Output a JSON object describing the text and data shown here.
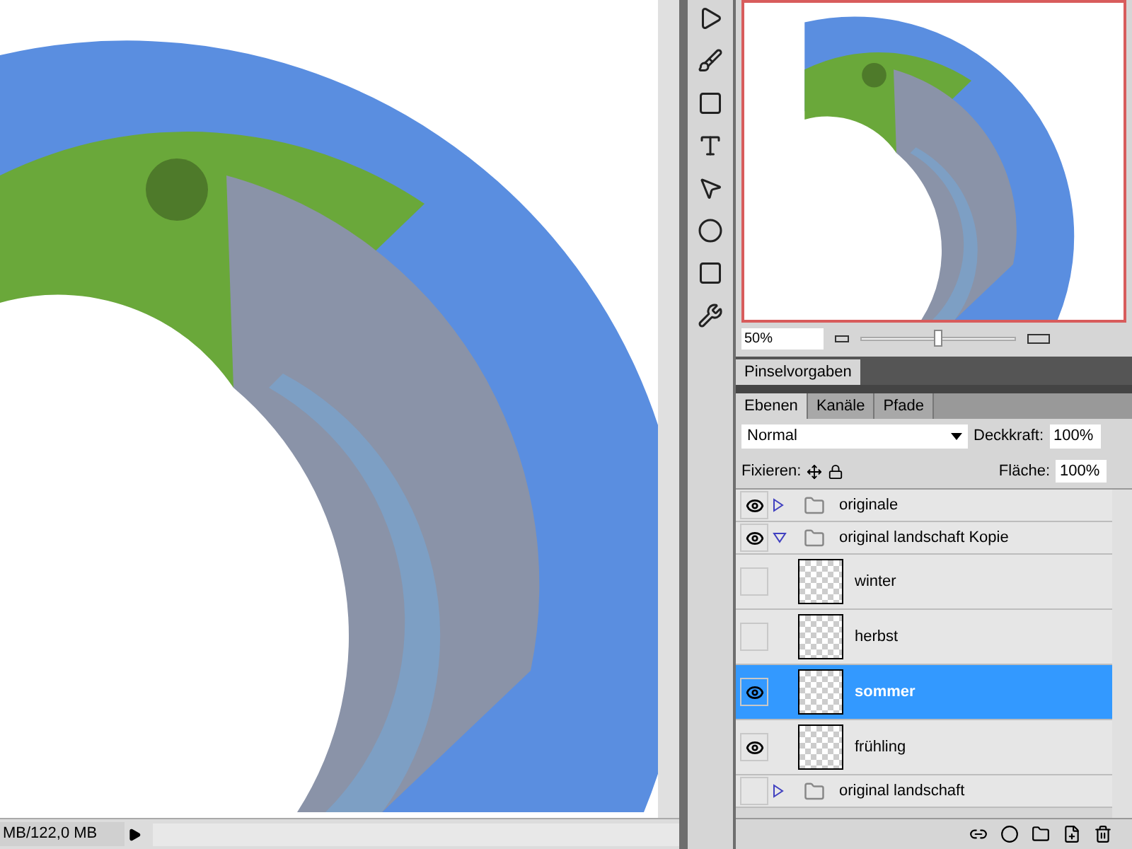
{
  "status_bar": {
    "doc_size": "MB/122,0 MB"
  },
  "navigator": {
    "zoom": "50%",
    "level": 0.5
  },
  "brush_panel": {
    "tabs": [
      {
        "label": "Pinselvorgaben",
        "selected": true
      }
    ]
  },
  "layers_panel": {
    "tabs": [
      {
        "label": "Ebenen",
        "selected": true
      },
      {
        "label": "Kanäle",
        "selected": false
      },
      {
        "label": "Pfade",
        "selected": false
      }
    ],
    "blend_mode": "Normal",
    "opacity_label": "Deckkraft:",
    "opacity": "100%",
    "lock_label": "Fixieren:",
    "fill_label": "Fläche:",
    "fill": "100%",
    "layers": [
      {
        "kind": "folder",
        "name": "originale",
        "visible": true,
        "expanded": false,
        "selected": false
      },
      {
        "kind": "folder",
        "name": "original landschaft Kopie",
        "visible": true,
        "expanded": true,
        "selected": false,
        "children": [
          {
            "kind": "layer",
            "name": "winter",
            "visible": false,
            "selected": false
          },
          {
            "kind": "layer",
            "name": "herbst",
            "visible": false,
            "selected": false
          },
          {
            "kind": "layer",
            "name": "sommer",
            "visible": true,
            "selected": true
          },
          {
            "kind": "layer",
            "name": "frühling",
            "visible": true,
            "selected": false
          }
        ]
      },
      {
        "kind": "folder",
        "name": "original landschaft",
        "visible": false,
        "expanded": false,
        "selected": false
      }
    ]
  }
}
